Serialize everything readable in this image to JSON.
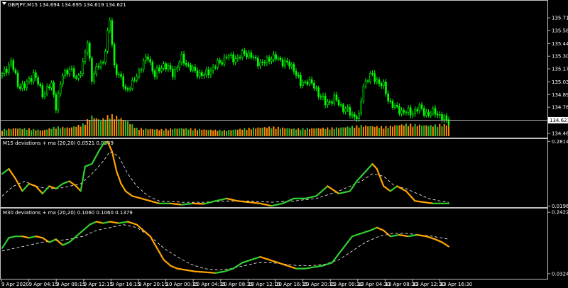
{
  "window": {
    "symbol_menu_icon": "dropdown-triangle-icon"
  },
  "colors": {
    "background": "#000000",
    "frame": "#c0c0c0",
    "bull_candle": "#00ff00",
    "bear_candle": "#00aa00",
    "volume_up": "#2fbf2f",
    "volume_down": "#ff8c00",
    "osc_up": "#32cd32",
    "osc_down": "#ffa500",
    "ma_line": "#ffffff",
    "text": "#ffffff"
  },
  "chart_data": [
    {
      "type": "candlestick",
      "title": "GBPJPY,M15 134.694 134.695 134.619 134.621",
      "ylim": [
        134.45,
        135.83
      ],
      "y_ticks": [
        "135.715",
        "135.580",
        "135.440",
        "135.305",
        "135.170",
        "135.030",
        "134.895",
        "134.760",
        "134.480"
      ],
      "current_price": "134.621",
      "close_path": [
        [
          0,
          135.1
        ],
        [
          4,
          135.25
        ],
        [
          7,
          135.0
        ],
        [
          10,
          134.98
        ],
        [
          14,
          135.12
        ],
        [
          18,
          134.9
        ],
        [
          22,
          135.0
        ],
        [
          24,
          134.78
        ],
        [
          27,
          135.1
        ],
        [
          30,
          135.18
        ],
        [
          33,
          135.05
        ],
        [
          36,
          135.22
        ],
        [
          38,
          135.45
        ],
        [
          40,
          135.08
        ],
        [
          43,
          135.2
        ],
        [
          45,
          135.25
        ],
        [
          48,
          135.68
        ],
        [
          50,
          135.2
        ],
        [
          53,
          135.05
        ],
        [
          55,
          134.95
        ],
        [
          58,
          135.0
        ],
        [
          62,
          135.2
        ],
        [
          65,
          135.3
        ],
        [
          68,
          135.1
        ],
        [
          72,
          135.22
        ],
        [
          76,
          135.12
        ],
        [
          80,
          135.28
        ],
        [
          85,
          135.15
        ],
        [
          90,
          135.1
        ],
        [
          95,
          135.2
        ],
        [
          100,
          135.3
        ],
        [
          105,
          135.28
        ],
        [
          108,
          135.35
        ],
        [
          112,
          135.28
        ],
        [
          116,
          135.22
        ],
        [
          120,
          135.3
        ],
        [
          125,
          135.25
        ],
        [
          130,
          135.18
        ],
        [
          133,
          135.0
        ],
        [
          136,
          135.05
        ],
        [
          140,
          134.95
        ],
        [
          144,
          134.8
        ],
        [
          148,
          134.85
        ],
        [
          152,
          134.75
        ],
        [
          156,
          134.68
        ],
        [
          159,
          134.65
        ],
        [
          161,
          135.0
        ],
        [
          164,
          135.1
        ],
        [
          167,
          135.05
        ],
        [
          170,
          134.98
        ],
        [
          172,
          134.85
        ],
        [
          175,
          134.75
        ],
        [
          178,
          134.72
        ],
        [
          182,
          134.7
        ],
        [
          186,
          134.75
        ],
        [
          190,
          134.68
        ],
        [
          193,
          134.72
        ],
        [
          196,
          134.64
        ],
        [
          199,
          134.62
        ]
      ],
      "volume": [
        [
          0,
          0.25,
          "up"
        ],
        [
          6,
          0.3,
          "down"
        ],
        [
          12,
          0.28,
          "up"
        ],
        [
          18,
          0.22,
          "down"
        ],
        [
          24,
          0.35,
          "up"
        ],
        [
          30,
          0.32,
          "down"
        ],
        [
          36,
          0.45,
          "down"
        ],
        [
          40,
          0.75,
          "down"
        ],
        [
          44,
          0.6,
          "up"
        ],
        [
          48,
          0.8,
          "down"
        ],
        [
          52,
          0.7,
          "down"
        ],
        [
          56,
          0.55,
          "up"
        ],
        [
          60,
          0.3,
          "down"
        ],
        [
          70,
          0.25,
          "down"
        ],
        [
          80,
          0.3,
          "up"
        ],
        [
          90,
          0.25,
          "down"
        ],
        [
          100,
          0.22,
          "up"
        ],
        [
          110,
          0.3,
          "down"
        ],
        [
          120,
          0.35,
          "down"
        ],
        [
          130,
          0.28,
          "up"
        ],
        [
          140,
          0.3,
          "down"
        ],
        [
          150,
          0.32,
          "up"
        ],
        [
          160,
          0.4,
          "down"
        ],
        [
          170,
          0.35,
          "down"
        ],
        [
          180,
          0.45,
          "down"
        ],
        [
          190,
          0.4,
          "up"
        ],
        [
          199,
          0.45,
          "down"
        ]
      ]
    },
    {
      "type": "line",
      "title": "M15 deviations + ma (20,20) 0.0521 0.0549",
      "ylim": [
        0.018,
        0.288
      ],
      "y_ticks": [
        "0.2814",
        "0.0196"
      ],
      "series": [
        {
          "role": "oscillator",
          "points": [
            [
              0,
              0.15
            ],
            [
              3,
              0.17
            ],
            [
              6,
              0.13
            ],
            [
              9,
              0.08
            ],
            [
              12,
              0.11
            ],
            [
              15,
              0.1
            ],
            [
              18,
              0.07
            ],
            [
              21,
              0.1
            ],
            [
              24,
              0.09
            ],
            [
              27,
              0.11
            ],
            [
              30,
              0.12
            ],
            [
              33,
              0.1
            ],
            [
              35,
              0.08
            ],
            [
              37,
              0.18
            ],
            [
              40,
              0.19
            ],
            [
              43,
              0.24
            ],
            [
              45,
              0.27
            ],
            [
              47,
              0.28
            ],
            [
              49,
              0.24
            ],
            [
              51,
              0.16
            ],
            [
              53,
              0.11
            ],
            [
              55,
              0.08
            ],
            [
              58,
              0.06
            ],
            [
              62,
              0.05
            ],
            [
              66,
              0.04
            ],
            [
              70,
              0.03
            ],
            [
              75,
              0.03
            ],
            [
              80,
              0.025
            ],
            [
              85,
              0.03
            ],
            [
              90,
              0.028
            ],
            [
              95,
              0.04
            ],
            [
              100,
              0.05
            ],
            [
              105,
              0.04
            ],
            [
              110,
              0.035
            ],
            [
              115,
              0.03
            ],
            [
              120,
              0.02
            ],
            [
              125,
              0.03
            ],
            [
              130,
              0.05
            ],
            [
              135,
              0.05
            ],
            [
              140,
              0.06
            ],
            [
              145,
              0.1
            ],
            [
              150,
              0.07
            ],
            [
              155,
              0.08
            ],
            [
              158,
              0.12
            ],
            [
              162,
              0.16
            ],
            [
              165,
              0.19
            ],
            [
              167,
              0.17
            ],
            [
              170,
              0.1
            ],
            [
              173,
              0.08
            ],
            [
              176,
              0.1
            ],
            [
              180,
              0.08
            ],
            [
              184,
              0.04
            ],
            [
              188,
              0.035
            ],
            [
              192,
              0.03
            ],
            [
              196,
              0.03
            ],
            [
              199,
              0.03
            ]
          ]
        },
        {
          "role": "ma",
          "points": [
            [
              0,
              0.06
            ],
            [
              5,
              0.1
            ],
            [
              10,
              0.12
            ],
            [
              15,
              0.1
            ],
            [
              20,
              0.09
            ],
            [
              25,
              0.09
            ],
            [
              30,
              0.1
            ],
            [
              35,
              0.11
            ],
            [
              40,
              0.15
            ],
            [
              45,
              0.2
            ],
            [
              48,
              0.24
            ],
            [
              52,
              0.22
            ],
            [
              56,
              0.15
            ],
            [
              60,
              0.1
            ],
            [
              65,
              0.06
            ],
            [
              70,
              0.04
            ],
            [
              80,
              0.035
            ],
            [
              90,
              0.035
            ],
            [
              100,
              0.04
            ],
            [
              110,
              0.04
            ],
            [
              120,
              0.035
            ],
            [
              130,
              0.04
            ],
            [
              140,
              0.05
            ],
            [
              150,
              0.08
            ],
            [
              155,
              0.1
            ],
            [
              160,
              0.12
            ],
            [
              165,
              0.15
            ],
            [
              170,
              0.14
            ],
            [
              175,
              0.1
            ],
            [
              180,
              0.09
            ],
            [
              185,
              0.07
            ],
            [
              190,
              0.05
            ],
            [
              195,
              0.04
            ],
            [
              199,
              0.035
            ]
          ]
        }
      ]
    },
    {
      "type": "line",
      "title": "M30 deviations + ma (20,20) 0.1060 0.1060 0.1379",
      "ylim": [
        0.02,
        0.25
      ],
      "y_ticks": [
        "0.2422",
        "0.0324"
      ],
      "series": [
        {
          "role": "oscillator",
          "points": [
            [
              0,
              0.12
            ],
            [
              3,
              0.155
            ],
            [
              6,
              0.16
            ],
            [
              9,
              0.16
            ],
            [
              12,
              0.155
            ],
            [
              15,
              0.16
            ],
            [
              18,
              0.155
            ],
            [
              21,
              0.14
            ],
            [
              24,
              0.15
            ],
            [
              27,
              0.13
            ],
            [
              30,
              0.14
            ],
            [
              33,
              0.16
            ],
            [
              36,
              0.18
            ],
            [
              39,
              0.2
            ],
            [
              42,
              0.21
            ],
            [
              45,
              0.205
            ],
            [
              48,
              0.21
            ],
            [
              52,
              0.205
            ],
            [
              56,
              0.21
            ],
            [
              60,
              0.2
            ],
            [
              63,
              0.18
            ],
            [
              66,
              0.16
            ],
            [
              69,
              0.12
            ],
            [
              72,
              0.08
            ],
            [
              75,
              0.06
            ],
            [
              78,
              0.05
            ],
            [
              82,
              0.045
            ],
            [
              86,
              0.04
            ],
            [
              90,
              0.038
            ],
            [
              95,
              0.035
            ],
            [
              99,
              0.04
            ],
            [
              103,
              0.05
            ],
            [
              107,
              0.07
            ],
            [
              111,
              0.08
            ],
            [
              115,
              0.09
            ],
            [
              119,
              0.08
            ],
            [
              123,
              0.07
            ],
            [
              127,
              0.06
            ],
            [
              131,
              0.05
            ],
            [
              135,
              0.05
            ],
            [
              139,
              0.055
            ],
            [
              143,
              0.06
            ],
            [
              147,
              0.07
            ],
            [
              150,
              0.1
            ],
            [
              153,
              0.13
            ],
            [
              156,
              0.16
            ],
            [
              160,
              0.17
            ],
            [
              164,
              0.18
            ],
            [
              167,
              0.19
            ],
            [
              170,
              0.18
            ],
            [
              173,
              0.16
            ],
            [
              177,
              0.165
            ],
            [
              181,
              0.16
            ],
            [
              185,
              0.165
            ],
            [
              189,
              0.16
            ],
            [
              193,
              0.15
            ],
            [
              196,
              0.14
            ],
            [
              199,
              0.125
            ]
          ]
        },
        {
          "role": "ma",
          "points": [
            [
              0,
              0.11
            ],
            [
              6,
              0.12
            ],
            [
              12,
              0.13
            ],
            [
              18,
              0.14
            ],
            [
              24,
              0.145
            ],
            [
              30,
              0.15
            ],
            [
              36,
              0.16
            ],
            [
              42,
              0.18
            ],
            [
              48,
              0.19
            ],
            [
              54,
              0.2
            ],
            [
              60,
              0.19
            ],
            [
              66,
              0.16
            ],
            [
              72,
              0.12
            ],
            [
              78,
              0.09
            ],
            [
              84,
              0.065
            ],
            [
              90,
              0.05
            ],
            [
              96,
              0.045
            ],
            [
              102,
              0.05
            ],
            [
              108,
              0.06
            ],
            [
              114,
              0.07
            ],
            [
              120,
              0.07
            ],
            [
              126,
              0.065
            ],
            [
              132,
              0.06
            ],
            [
              138,
              0.06
            ],
            [
              144,
              0.065
            ],
            [
              150,
              0.08
            ],
            [
              156,
              0.11
            ],
            [
              162,
              0.14
            ],
            [
              168,
              0.16
            ],
            [
              174,
              0.17
            ],
            [
              180,
              0.17
            ],
            [
              186,
              0.165
            ],
            [
              192,
              0.16
            ],
            [
              199,
              0.15
            ]
          ]
        }
      ]
    }
  ],
  "x_axis": {
    "ticks": [
      "9 Apr 2020",
      "9 Apr 04:15",
      "9 Apr 08:15",
      "9 Apr 12:15",
      "9 Apr 16:15",
      "9 Apr 20:15",
      "10 Apr 00:15",
      "10 Apr 04:15",
      "10 Apr 08:15",
      "10 Apr 12:15",
      "10 Apr 16:15",
      "10 Apr 20:15",
      "13 Apr 00:30",
      "13 Apr 04:30",
      "13 Apr 08:30",
      "13 Apr 12:30",
      "13 Apr 16:30"
    ]
  }
}
